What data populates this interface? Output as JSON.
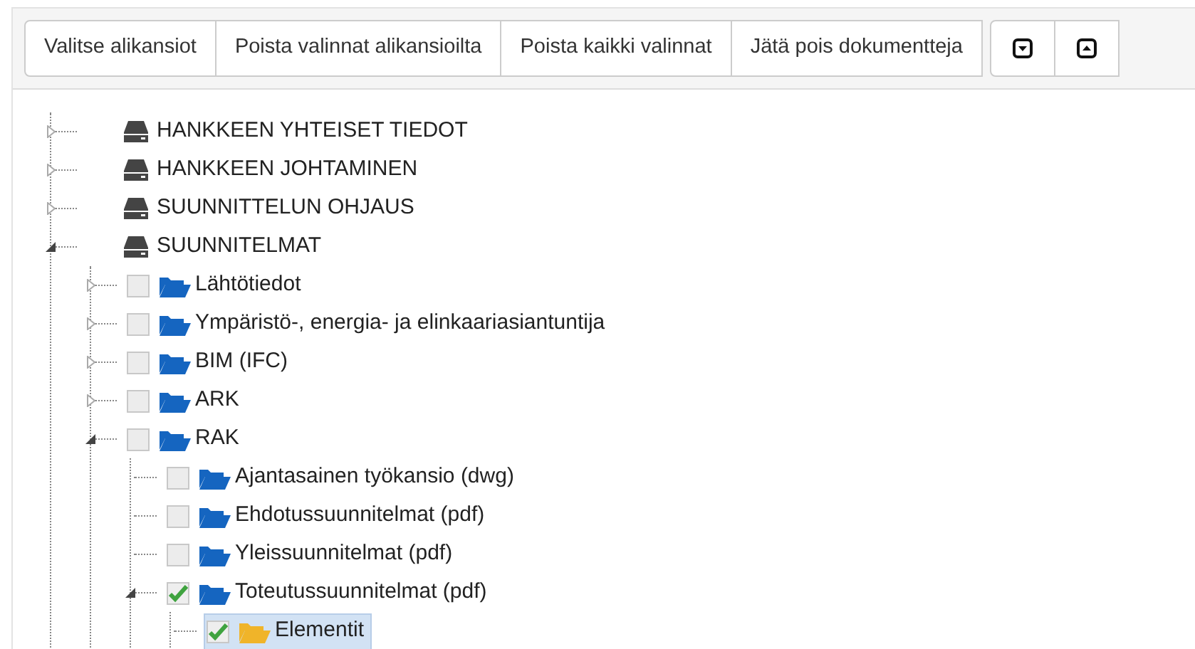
{
  "toolbar": {
    "buttons": [
      {
        "label": "Valitse alikansiot"
      },
      {
        "label": "Poista valinnat alikansioilta"
      },
      {
        "label": "Poista kaikki valinnat"
      },
      {
        "label": "Jätä pois dokumentteja"
      }
    ],
    "icon_buttons": [
      {
        "kind": "expand-all"
      },
      {
        "kind": "collapse-all"
      }
    ]
  },
  "tree": [
    {
      "label": "HANKKEEN YHTEISET TIEDOT",
      "kind": "drive",
      "expanded": false,
      "selected": false
    },
    {
      "label": "HANKKEEN JOHTAMINEN",
      "kind": "drive",
      "expanded": false,
      "selected": false
    },
    {
      "label": "SUUNNITTELUN OHJAUS",
      "kind": "drive",
      "expanded": false,
      "selected": false
    },
    {
      "label": "SUUNNITELMAT",
      "kind": "drive",
      "expanded": true,
      "selected": false,
      "children": [
        {
          "label": "Lähtötiedot",
          "kind": "folder",
          "expanded": false,
          "checked": false,
          "selected": false
        },
        {
          "label": "Ympäristö-, energia- ja elinkaariasiantuntija",
          "kind": "folder",
          "expanded": false,
          "checked": false,
          "selected": false
        },
        {
          "label": "BIM (IFC)",
          "kind": "folder",
          "expanded": false,
          "checked": false,
          "selected": false
        },
        {
          "label": "ARK",
          "kind": "folder",
          "expanded": false,
          "checked": false,
          "selected": false
        },
        {
          "label": "RAK",
          "kind": "folder",
          "expanded": true,
          "checked": false,
          "selected": false,
          "children": [
            {
              "label": "Ajantasainen työkansio (dwg)",
              "kind": "folder",
              "checked": false,
              "selected": false
            },
            {
              "label": "Ehdotussuunnitelmat (pdf)",
              "kind": "folder",
              "checked": false,
              "selected": false
            },
            {
              "label": "Yleissuunnitelmat (pdf)",
              "kind": "folder",
              "checked": false,
              "selected": false
            },
            {
              "label": "Toteutussuunnitelmat (pdf)",
              "kind": "folder",
              "expanded": true,
              "checked": true,
              "selected": false,
              "children": [
                {
                  "label": "Elementit",
                  "kind": "folder",
                  "checked": true,
                  "selected": true
                }
              ]
            }
          ]
        }
      ]
    }
  ]
}
